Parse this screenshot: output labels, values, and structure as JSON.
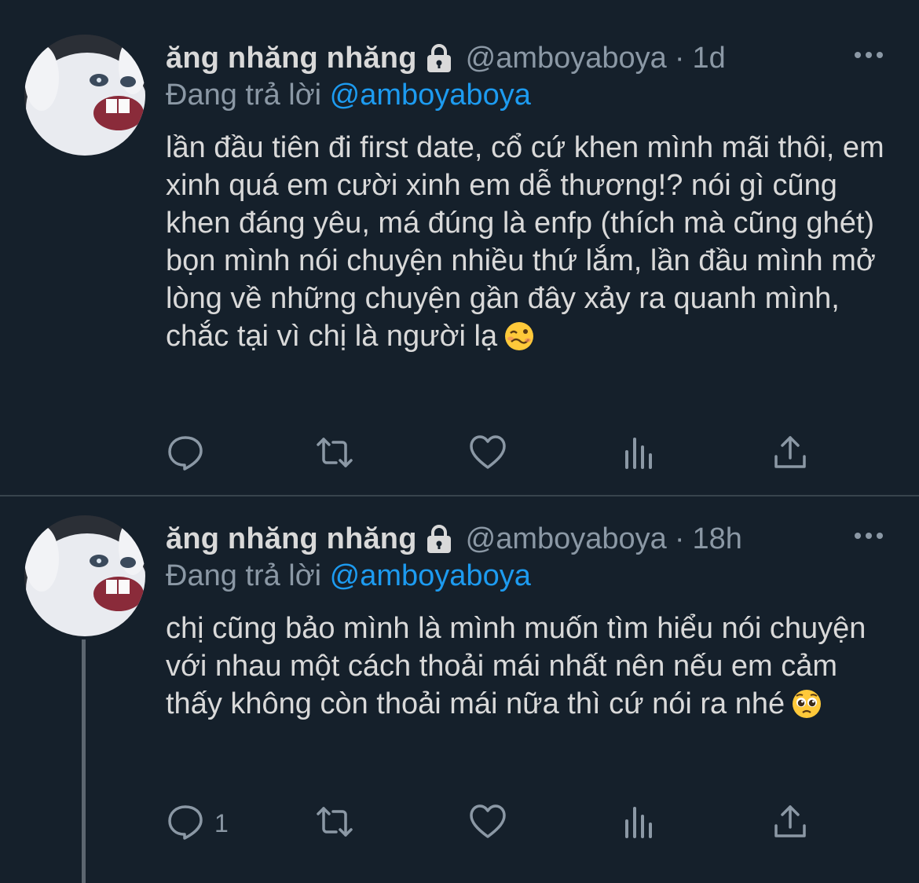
{
  "tweets": [
    {
      "author_name": "ăng nhăng nhăng",
      "handle": "@amboyaboya",
      "separator": "·",
      "time": "1d",
      "replying_prefix": "Đang trả lời",
      "replying_to": "@amboyaboya",
      "text": "lần đầu tiên đi first date, cổ cứ khen mình mãi thôi, em xinh quá em cười xinh em dễ thương!? nói gì cũng khen đáng yêu, má đúng là enfp (thích mà cũng ghét) bọn mình nói chuyện nhiều thứ lắm, lần đầu mình mở lòng về những chuyện gần đây xảy ra quanh mình, chắc tại vì chị là người lạ",
      "emoji": "woozy-face",
      "reply_count": ""
    },
    {
      "author_name": "ăng nhăng nhăng",
      "handle": "@amboyaboya",
      "separator": "·",
      "time": "18h",
      "replying_prefix": "Đang trả lời",
      "replying_to": "@amboyaboya",
      "text": "chị cũng bảo mình là mình muốn tìm hiểu nói chuyện với nhau một cách thoải mái nhất nên nếu em cảm thấy không còn thoải mái nữa thì cứ nói ra nhé",
      "emoji": "pleading-face",
      "reply_count": "1"
    }
  ],
  "icons": [
    "lock-icon",
    "more-icon",
    "reply-icon",
    "retweet-icon",
    "like-icon",
    "views-icon",
    "share-icon"
  ],
  "colors": {
    "background": "#15202b",
    "text": "#d9d9d9",
    "muted": "#8b98a5",
    "link": "#1d9bf0",
    "divider": "#38444d"
  }
}
